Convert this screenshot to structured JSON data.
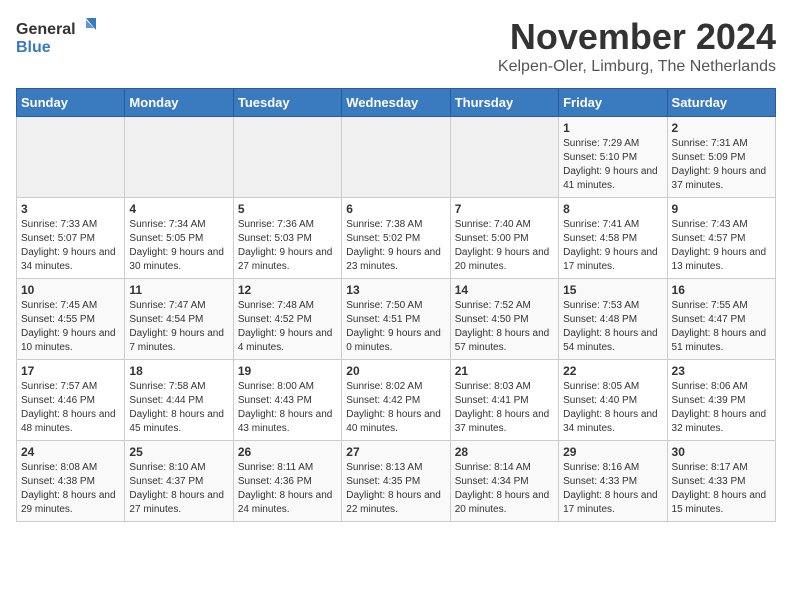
{
  "header": {
    "logo_general": "General",
    "logo_blue": "Blue",
    "month_title": "November 2024",
    "location": "Kelpen-Oler, Limburg, The Netherlands"
  },
  "weekdays": [
    "Sunday",
    "Monday",
    "Tuesday",
    "Wednesday",
    "Thursday",
    "Friday",
    "Saturday"
  ],
  "weeks": [
    [
      {
        "day": "",
        "info": ""
      },
      {
        "day": "",
        "info": ""
      },
      {
        "day": "",
        "info": ""
      },
      {
        "day": "",
        "info": ""
      },
      {
        "day": "",
        "info": ""
      },
      {
        "day": "1",
        "info": "Sunrise: 7:29 AM\nSunset: 5:10 PM\nDaylight: 9 hours and 41 minutes."
      },
      {
        "day": "2",
        "info": "Sunrise: 7:31 AM\nSunset: 5:09 PM\nDaylight: 9 hours and 37 minutes."
      }
    ],
    [
      {
        "day": "3",
        "info": "Sunrise: 7:33 AM\nSunset: 5:07 PM\nDaylight: 9 hours and 34 minutes."
      },
      {
        "day": "4",
        "info": "Sunrise: 7:34 AM\nSunset: 5:05 PM\nDaylight: 9 hours and 30 minutes."
      },
      {
        "day": "5",
        "info": "Sunrise: 7:36 AM\nSunset: 5:03 PM\nDaylight: 9 hours and 27 minutes."
      },
      {
        "day": "6",
        "info": "Sunrise: 7:38 AM\nSunset: 5:02 PM\nDaylight: 9 hours and 23 minutes."
      },
      {
        "day": "7",
        "info": "Sunrise: 7:40 AM\nSunset: 5:00 PM\nDaylight: 9 hours and 20 minutes."
      },
      {
        "day": "8",
        "info": "Sunrise: 7:41 AM\nSunset: 4:58 PM\nDaylight: 9 hours and 17 minutes."
      },
      {
        "day": "9",
        "info": "Sunrise: 7:43 AM\nSunset: 4:57 PM\nDaylight: 9 hours and 13 minutes."
      }
    ],
    [
      {
        "day": "10",
        "info": "Sunrise: 7:45 AM\nSunset: 4:55 PM\nDaylight: 9 hours and 10 minutes."
      },
      {
        "day": "11",
        "info": "Sunrise: 7:47 AM\nSunset: 4:54 PM\nDaylight: 9 hours and 7 minutes."
      },
      {
        "day": "12",
        "info": "Sunrise: 7:48 AM\nSunset: 4:52 PM\nDaylight: 9 hours and 4 minutes."
      },
      {
        "day": "13",
        "info": "Sunrise: 7:50 AM\nSunset: 4:51 PM\nDaylight: 9 hours and 0 minutes."
      },
      {
        "day": "14",
        "info": "Sunrise: 7:52 AM\nSunset: 4:50 PM\nDaylight: 8 hours and 57 minutes."
      },
      {
        "day": "15",
        "info": "Sunrise: 7:53 AM\nSunset: 4:48 PM\nDaylight: 8 hours and 54 minutes."
      },
      {
        "day": "16",
        "info": "Sunrise: 7:55 AM\nSunset: 4:47 PM\nDaylight: 8 hours and 51 minutes."
      }
    ],
    [
      {
        "day": "17",
        "info": "Sunrise: 7:57 AM\nSunset: 4:46 PM\nDaylight: 8 hours and 48 minutes."
      },
      {
        "day": "18",
        "info": "Sunrise: 7:58 AM\nSunset: 4:44 PM\nDaylight: 8 hours and 45 minutes."
      },
      {
        "day": "19",
        "info": "Sunrise: 8:00 AM\nSunset: 4:43 PM\nDaylight: 8 hours and 43 minutes."
      },
      {
        "day": "20",
        "info": "Sunrise: 8:02 AM\nSunset: 4:42 PM\nDaylight: 8 hours and 40 minutes."
      },
      {
        "day": "21",
        "info": "Sunrise: 8:03 AM\nSunset: 4:41 PM\nDaylight: 8 hours and 37 minutes."
      },
      {
        "day": "22",
        "info": "Sunrise: 8:05 AM\nSunset: 4:40 PM\nDaylight: 8 hours and 34 minutes."
      },
      {
        "day": "23",
        "info": "Sunrise: 8:06 AM\nSunset: 4:39 PM\nDaylight: 8 hours and 32 minutes."
      }
    ],
    [
      {
        "day": "24",
        "info": "Sunrise: 8:08 AM\nSunset: 4:38 PM\nDaylight: 8 hours and 29 minutes."
      },
      {
        "day": "25",
        "info": "Sunrise: 8:10 AM\nSunset: 4:37 PM\nDaylight: 8 hours and 27 minutes."
      },
      {
        "day": "26",
        "info": "Sunrise: 8:11 AM\nSunset: 4:36 PM\nDaylight: 8 hours and 24 minutes."
      },
      {
        "day": "27",
        "info": "Sunrise: 8:13 AM\nSunset: 4:35 PM\nDaylight: 8 hours and 22 minutes."
      },
      {
        "day": "28",
        "info": "Sunrise: 8:14 AM\nSunset: 4:34 PM\nDaylight: 8 hours and 20 minutes."
      },
      {
        "day": "29",
        "info": "Sunrise: 8:16 AM\nSunset: 4:33 PM\nDaylight: 8 hours and 17 minutes."
      },
      {
        "day": "30",
        "info": "Sunrise: 8:17 AM\nSunset: 4:33 PM\nDaylight: 8 hours and 15 minutes."
      }
    ]
  ]
}
